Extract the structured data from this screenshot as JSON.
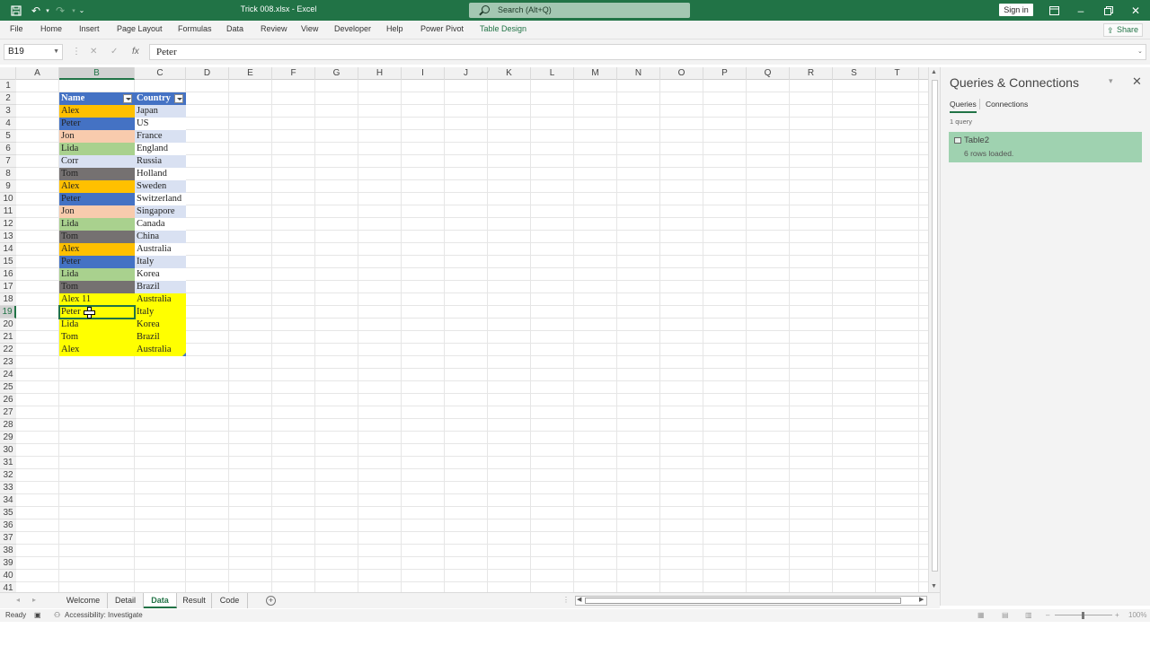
{
  "window": {
    "title": "Trick 008.xlsx  -  Excel",
    "search_placeholder": "Search (Alt+Q)",
    "sign_in": "Sign in"
  },
  "ribbon": {
    "tabs": [
      "File",
      "Home",
      "Insert",
      "Page Layout",
      "Formulas",
      "Data",
      "Review",
      "View",
      "Developer",
      "Help",
      "Power Pivot",
      "Table Design"
    ],
    "share": "Share"
  },
  "formula_bar": {
    "name_box": "B19",
    "cancel_icon": "✕",
    "enter_icon": "✓",
    "fx_label": "fx",
    "value": "Peter"
  },
  "sheet": {
    "columns": [
      "A",
      "B",
      "C",
      "D",
      "E",
      "F",
      "G",
      "H",
      "I",
      "J",
      "K",
      "L",
      "M",
      "N",
      "O",
      "P",
      "Q",
      "R",
      "S",
      "T"
    ],
    "rows": [
      "1",
      "2",
      "3",
      "4",
      "5",
      "6",
      "7",
      "8",
      "9",
      "10",
      "11",
      "12",
      "13",
      "14",
      "15",
      "16",
      "17",
      "18",
      "19",
      "20",
      "21",
      "22",
      "23",
      "24",
      "25",
      "26",
      "27",
      "28",
      "29",
      "30",
      "31",
      "32",
      "33",
      "34",
      "35",
      "36",
      "37",
      "38",
      "39",
      "40",
      "41"
    ],
    "selected_cell": "B19",
    "table": {
      "headers": [
        "Name",
        "Country"
      ],
      "header_color": "#4472c4",
      "rows": [
        {
          "name": "Alex",
          "country": "Japan",
          "fill": "#ffc000"
        },
        {
          "name": "Peter",
          "country": "US",
          "fill": "#4472c4"
        },
        {
          "name": "Jon",
          "country": "France",
          "fill": "#f8cbad"
        },
        {
          "name": "Lida",
          "country": "England",
          "fill": "#a9d18e"
        },
        {
          "name": "Corr",
          "country": "Russia",
          "fill": "#d9e1f2"
        },
        {
          "name": "Tom",
          "country": "Holland",
          "fill": "#757171"
        },
        {
          "name": "Alex",
          "country": "Sweden",
          "fill": "#ffc000"
        },
        {
          "name": "Peter",
          "country": "Switzerland",
          "fill": "#4472c4"
        },
        {
          "name": "Jon",
          "country": "Singapore",
          "fill": "#f8cbad"
        },
        {
          "name": "Lida",
          "country": "Canada",
          "fill": "#a9d18e"
        },
        {
          "name": "Tom",
          "country": "China",
          "fill": "#757171"
        },
        {
          "name": "Alex",
          "country": "Australia",
          "fill": "#ffc000"
        },
        {
          "name": "Peter",
          "country": "Italy",
          "fill": "#4472c4"
        },
        {
          "name": "Lida",
          "country": "Korea",
          "fill": "#a9d18e"
        },
        {
          "name": "Tom",
          "country": "Brazil",
          "fill": "#757171"
        },
        {
          "name": "Alex 11",
          "country": "Australia",
          "fill": "#ffff00"
        },
        {
          "name": "Peter",
          "country": "Italy",
          "fill": "#ffff00"
        },
        {
          "name": "Lida",
          "country": "Korea",
          "fill": "#ffff00"
        },
        {
          "name": "Tom",
          "country": "Brazil",
          "fill": "#ffff00"
        },
        {
          "name": "Alex",
          "country": "Australia",
          "fill": "#ffff00"
        }
      ],
      "band_colors": [
        "#d9e1f2",
        "#ffffff"
      ]
    }
  },
  "queries_panel": {
    "title": "Queries & Connections",
    "tabs": [
      "Queries",
      "Connections"
    ],
    "count": "1 query",
    "items": [
      {
        "name": "Table2",
        "status": "6 rows loaded."
      }
    ]
  },
  "sheet_tabs": [
    "Welcome",
    "Detail",
    "Data",
    "Result",
    "Code"
  ],
  "active_sheet": "Data",
  "status_bar": {
    "ready": "Ready",
    "accessibility": "Accessibility: Investigate",
    "zoom": "100%"
  },
  "colors": {
    "excel_green": "#217346",
    "table_header": "#4472c4",
    "query_item": "#9fd2b0"
  }
}
